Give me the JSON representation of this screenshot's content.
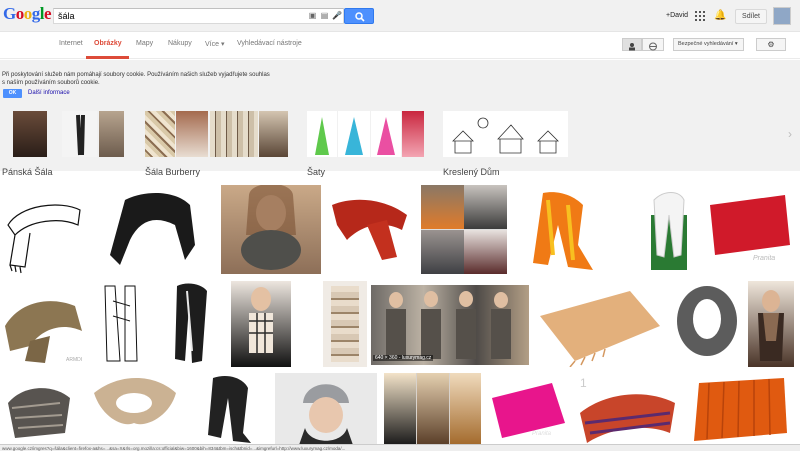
{
  "logo": {
    "letters": [
      "G",
      "o",
      "o",
      "g",
      "l",
      "e"
    ]
  },
  "search": {
    "value": "šála"
  },
  "header": {
    "user": "+David",
    "share": "Sdílet"
  },
  "nav": {
    "tabs": [
      "Internet",
      "Obrázky",
      "Mapy",
      "Nákupy",
      "Více ▾",
      "Vyhledávací nástroje"
    ],
    "active_tab": "Obrázky",
    "safe_search": "Bezpečné vyhledávání ▾"
  },
  "cookie": {
    "text": "Při poskytování služeb nám pomáhají soubory cookie. Používáním našich služeb vyjadřujete souhlas s naším používáním souborů cookie.",
    "ok": "OK",
    "more": "Další informace"
  },
  "related": [
    {
      "label": "Pánská Šála"
    },
    {
      "label": "Šála Burberry"
    },
    {
      "label": "Šaty"
    },
    {
      "label": "Kreslený Dům"
    }
  ],
  "image_caption": "640 × 360 - luxurymag.cz",
  "watermarks": [
    "ARMDI",
    "Pranita",
    "Pranita"
  ],
  "status_url": "www.google.cz/imgres?q=šála&client=firefox-a&hs=...&sa=X&rls=org.mozilla:cs:official&biw=1600&bih=834&tbm=isch&tbnid=...&imgrefurl=http://www.luxurymag.cz/moda/..."
}
